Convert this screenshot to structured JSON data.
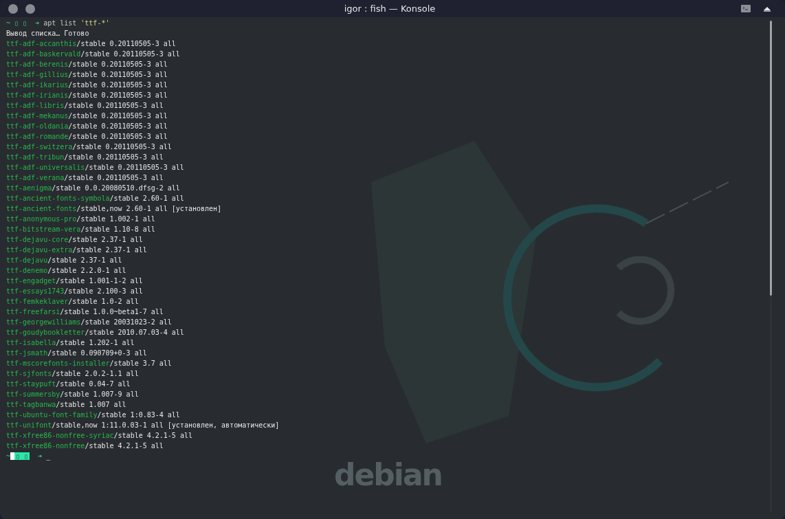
{
  "window": {
    "title": "igor : fish — Konsole"
  },
  "prompt": {
    "home": "~",
    "icons": "▯ ▯",
    "arrow": "➜",
    "command": "apt list",
    "argument": "'ttf-*'"
  },
  "status_line": "Вывод списка… Готово",
  "packages": [
    {
      "name": "ttf-adf-accanthis",
      "rest": "/stable 0.20110505-3 all"
    },
    {
      "name": "ttf-adf-baskervald",
      "rest": "/stable 0.20110505-3 all"
    },
    {
      "name": "ttf-adf-berenis",
      "rest": "/stable 0.20110505-3 all"
    },
    {
      "name": "ttf-adf-gillius",
      "rest": "/stable 0.20110505-3 all"
    },
    {
      "name": "ttf-adf-ikarius",
      "rest": "/stable 0.20110505-3 all"
    },
    {
      "name": "ttf-adf-irianis",
      "rest": "/stable 0.20110505-3 all"
    },
    {
      "name": "ttf-adf-libris",
      "rest": "/stable 0.20110505-3 all"
    },
    {
      "name": "ttf-adf-mekanus",
      "rest": "/stable 0.20110505-3 all"
    },
    {
      "name": "ttf-adf-oldania",
      "rest": "/stable 0.20110505-3 all"
    },
    {
      "name": "ttf-adf-romande",
      "rest": "/stable 0.20110505-3 all"
    },
    {
      "name": "ttf-adf-switzera",
      "rest": "/stable 0.20110505-3 all"
    },
    {
      "name": "ttf-adf-tribun",
      "rest": "/stable 0.20110505-3 all"
    },
    {
      "name": "ttf-adf-universalis",
      "rest": "/stable 0.20110505-3 all"
    },
    {
      "name": "ttf-adf-verana",
      "rest": "/stable 0.20110505-3 all"
    },
    {
      "name": "ttf-aenigma",
      "rest": "/stable 0.0.20080510.dfsg-2 all"
    },
    {
      "name": "ttf-ancient-fonts-symbola",
      "rest": "/stable 2.60-1 all"
    },
    {
      "name": "ttf-ancient-fonts",
      "rest": "/stable,now 2.60-1 all [установлен]"
    },
    {
      "name": "ttf-anonymous-pro",
      "rest": "/stable 1.002-1 all"
    },
    {
      "name": "ttf-bitstream-vera",
      "rest": "/stable 1.10-8 all"
    },
    {
      "name": "ttf-dejavu-core",
      "rest": "/stable 2.37-1 all"
    },
    {
      "name": "ttf-dejavu-extra",
      "rest": "/stable 2.37-1 all"
    },
    {
      "name": "ttf-dejavu",
      "rest": "/stable 2.37-1 all"
    },
    {
      "name": "ttf-denemo",
      "rest": "/stable 2.2.0-1 all"
    },
    {
      "name": "ttf-engadget",
      "rest": "/stable 1.001-1-2 all"
    },
    {
      "name": "ttf-essays1743",
      "rest": "/stable 2.100-3 all"
    },
    {
      "name": "ttf-femkeklaver",
      "rest": "/stable 1.0-2 all"
    },
    {
      "name": "ttf-freefarsi",
      "rest": "/stable 1.0.0~beta1-7 all"
    },
    {
      "name": "ttf-georgewilliams",
      "rest": "/stable 20031023-2 all"
    },
    {
      "name": "ttf-goudybookletter",
      "rest": "/stable 2010.07.03-4 all"
    },
    {
      "name": "ttf-isabella",
      "rest": "/stable 1.202-1 all"
    },
    {
      "name": "ttf-jsmath",
      "rest": "/stable 0.090709+0-3 all"
    },
    {
      "name": "ttf-mscorefonts-installer",
      "rest": "/stable 3.7 all"
    },
    {
      "name": "ttf-sjfonts",
      "rest": "/stable 2.0.2-1.1 all"
    },
    {
      "name": "ttf-staypuft",
      "rest": "/stable 0.04-7 all"
    },
    {
      "name": "ttf-summersby",
      "rest": "/stable 1.007-9 all"
    },
    {
      "name": "ttf-tagbanwa",
      "rest": "/stable 1.007 all"
    },
    {
      "name": "ttf-ubuntu-font-family",
      "rest": "/stable 1:0.83-4 all"
    },
    {
      "name": "ttf-unifont",
      "rest": "/stable,now 1:11.0.03-1 all [установлен, автоматически]"
    },
    {
      "name": "ttf-xfree86-nonfree-syriac",
      "rest": "/stable 4.2.1-5 all"
    },
    {
      "name": "ttf-xfree86-nonfree",
      "rest": "/stable 4.2.1-5 all"
    }
  ],
  "final_prompt": {
    "home": "~",
    "icons": "▯ ▯",
    "arrow": "➜",
    "cursor": "_"
  },
  "wallpaper": {
    "label": "debian"
  }
}
